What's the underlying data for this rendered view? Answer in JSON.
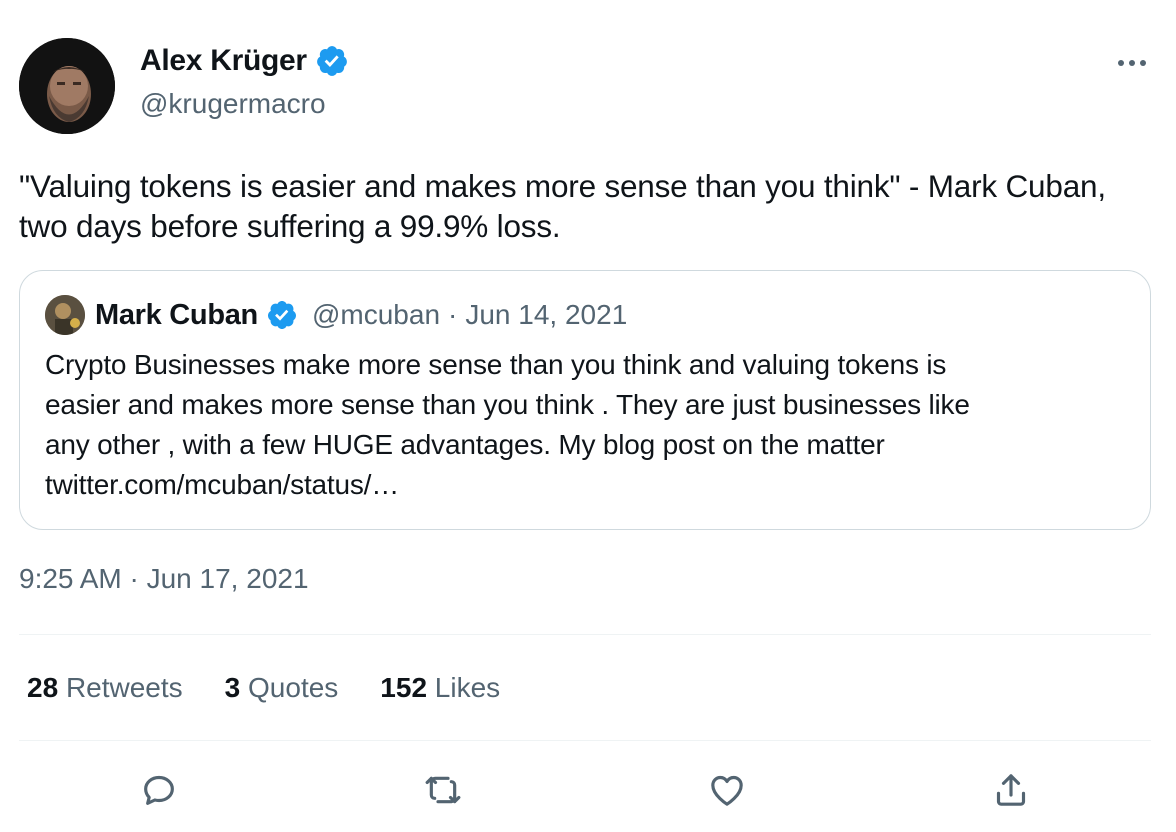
{
  "tweet": {
    "author": {
      "name": "Alex Krüger",
      "handle": "@krugermacro",
      "verified": true
    },
    "text": "\"Valuing tokens is easier and makes more sense than you think\" - Mark Cuban, two days before suffering a 99.9% loss.",
    "quote": {
      "author_name": "Mark Cuban",
      "handle": "@mcuban",
      "separator": "·",
      "date": "Jun 14, 2021",
      "text_lines": [
        "Crypto Businesses make more sense than you think and valuing tokens is",
        "easier and makes more sense than you think .  They are just businesses like",
        "any other , with a few HUGE advantages. My blog post on the matter",
        "twitter.com/mcuban/status/…"
      ]
    },
    "timestamp": "9:25 AM · Jun 17, 2021",
    "stats": [
      {
        "count": "28",
        "label": "Retweets"
      },
      {
        "count": "3",
        "label": "Quotes"
      },
      {
        "count": "152",
        "label": "Likes"
      }
    ]
  },
  "icons": {
    "more": "more-icon",
    "reply": "reply-icon",
    "retweet": "retweet-icon",
    "like": "heart-icon",
    "share": "share-icon",
    "verified": "verified-badge-icon"
  },
  "colors": {
    "text": "#0f1419",
    "secondary": "#536471",
    "verified": "#1d9bf0",
    "border": "#cfd9de"
  }
}
